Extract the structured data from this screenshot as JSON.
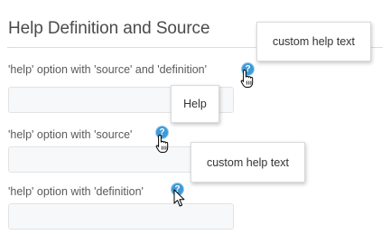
{
  "section": {
    "title": "Help Definition and Source"
  },
  "fields": [
    {
      "label": "'help' option with 'source' and 'definition'",
      "value": "",
      "help_icon": "question-circle-icon"
    },
    {
      "label": "'help' option with 'source'",
      "value": "",
      "help_icon": "question-circle-icon"
    },
    {
      "label": "'help' option with 'definition'",
      "value": "",
      "help_icon": "question-circle-icon"
    }
  ],
  "tooltips": {
    "top": "custom help text",
    "help": "Help",
    "middle": "custom help text"
  },
  "colors": {
    "help_icon": "#3d9ad8",
    "field_background": "#f6f8fa"
  }
}
